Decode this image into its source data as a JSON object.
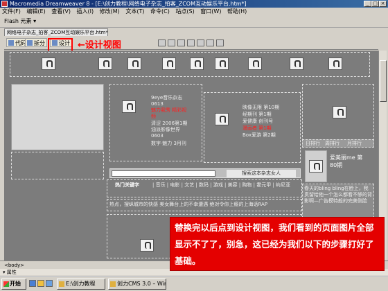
{
  "window": {
    "title": "Macromedia Dreamweaver 8 - [E:\\创力教程\\网络电子杂志_拍客_ZCOM互动娱乐平台.htm*]",
    "controls": [
      "_",
      "□",
      "×"
    ]
  },
  "menu": [
    "文件(F)",
    "编辑(E)",
    "查看(V)",
    "插入(I)",
    "修改(M)",
    "文本(T)",
    "命令(C)",
    "站点(S)",
    "窗口(W)",
    "帮助(H)"
  ],
  "insertbar": {
    "category": "Flash 元素"
  },
  "document": {
    "tab": "网络电子杂志_拍客_ZCOM互动娱乐平台.htm*"
  },
  "toolbar": {
    "code": "代码",
    "split": "拆分",
    "design": "设计"
  },
  "annotation": {
    "arrow_label": "←设计视图"
  },
  "canvas": {
    "col2": {
      "lines": [
        "9eye音乐杂志",
        "0613",
        "魅力我秀 精彩视",
        "频",
        "清涩 2006第1期",
        "油派影像世界",
        "0603",
        "数字·魅力 3月刊"
      ]
    },
    "col3": {
      "lines": [
        "映像无限 第10期",
        "经期刊 第1期",
        "爱健康 创刊号",
        "漫画者 第1期",
        "Box爱游 第2期"
      ]
    },
    "ranking": {
      "tabs": [
        "日排行",
        "周排行",
        "月排行"
      ],
      "item_title": "爱美丽me 第",
      "item_sub": "80期"
    },
    "search": {
      "button": "搜索这本杂志女人"
    },
    "hot": {
      "title": "热门关键字",
      "keywords": "| 音乐 | 电影 | 文艺 | 数码 | 游戏 | 美容 | 购物 | 霍元甲 | 屿尼亚"
    },
    "story": {
      "text": "热点，搜纵城市的快感  美女舞台上的不幸遭遇  绝对令你上瘾的上海话RAP"
    },
    "side_text": "春天的bling bling在脸上，我贯留给他一个怎么都看不够的背影啊—广告模特般的完美侧脸"
  },
  "status": {
    "label": "<body>"
  },
  "properties": {
    "label": "属性"
  },
  "taskbar": {
    "start": "开始",
    "tasks": [
      "E:\\创力教程",
      "创力CMS 3.0 – Windows..."
    ],
    "tasks_extra": "Macromedia Dreamweaver 8"
  },
  "instruction": {
    "text": "替换完以后点到设计视图，我们看到的页面图片全部显示不了了，别急，这已经为我们以下的步骤打好了基础。"
  },
  "colors": {
    "callout": "#ff0000",
    "canvas_bg": "#7c7c7c",
    "note_bg": "#e40000"
  }
}
